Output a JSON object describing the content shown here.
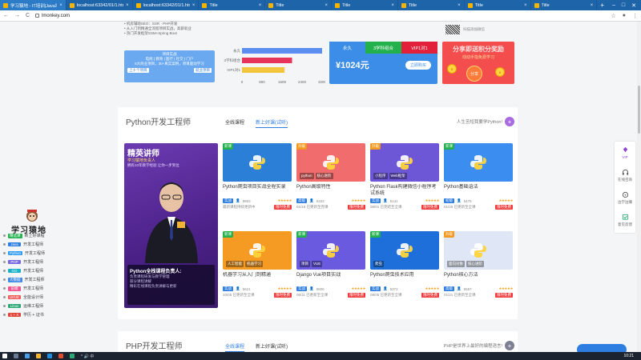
{
  "browser": {
    "tabs": [
      {
        "label": "学习猿地 - IT培训|Java培训",
        "active": true
      },
      {
        "label": "localhost:63342/01/1.html",
        "active": false
      },
      {
        "label": "localhost:63342/01/1.html",
        "active": false
      },
      {
        "label": "Title",
        "active": false
      },
      {
        "label": "Title",
        "active": false
      },
      {
        "label": "Title",
        "active": false
      },
      {
        "label": "Title",
        "active": false
      },
      {
        "label": "Title",
        "active": false
      },
      {
        "label": "Title",
        "active": false
      }
    ],
    "close_glyph": "×",
    "newtab_glyph": "+",
    "url": "lmonkey.com",
    "win_controls": {
      "min": "–",
      "max": "□",
      "close": "✕"
    },
    "nav": {
      "back": "←",
      "forward": "→",
      "reload": "C"
    },
    "addr_right": {
      "star": "☆",
      "account": "●",
      "menu": "⋮"
    }
  },
  "promo": {
    "lines": [
      "• 机房辅助SEO：SSR · PHP开发",
      "• 从入门到精通全流程项目实战，高薪就业",
      "• 热门开发框架SSM+Spring Boot"
    ],
    "notice_box": {
      "title": "项目实战",
      "line1": "电商 | 教育 | 医疗 | 社交 | 门户",
      "line2": "5大商业项目，30+真实案例，项目驱动学习",
      "btn_left": "上十个项目",
      "btn_right": "就业项目"
    },
    "mini_chart": {
      "categories": [
        "永久",
        "3学科组合",
        "VIP1对1"
      ],
      "ticks": [
        "0",
        "800",
        "1600",
        "2400",
        "3200"
      ]
    },
    "price_card": {
      "tabs": [
        "永久",
        "3学科组合",
        "VIP1对1"
      ],
      "price": "¥1024元",
      "buy": "立即购买"
    },
    "share_card": {
      "title": "分享即送积分奖励",
      "subtitle": "动动手指免费学习",
      "button": "分享"
    },
    "qr_text": "扫描添加微信"
  },
  "chart_data": {
    "type": "bar",
    "categories": [
      "永久",
      "3学科组合",
      "VIP1对1"
    ],
    "values": [
      3200,
      2000,
      1700
    ],
    "xlim": [
      0,
      3200
    ],
    "series_colors": [
      "#5b8ef0",
      "#e7345a",
      "#f3c53c"
    ]
  },
  "python_section": {
    "title": "Python开发工程师",
    "tabs": [
      "全线课程",
      "新上好课(试听)"
    ],
    "right_text": "人生苦短我要学Python!",
    "plus": "+",
    "teacher": {
      "title": "精英讲师",
      "subtitle": "学习猿地负责人",
      "subtitle2": "拥有10年教学经验 让你一步到位",
      "card_title": "Python全栈课程负责人:",
      "card_lines": [
        "负责课程研发与教学管理",
        "部分课程讲解",
        "精彩在线课程负责讲解与更新"
      ]
    },
    "courses": [
      {
        "badge": "新课",
        "badge_type": "new",
        "title": "Python爬虫项目实战全程实录",
        "level": "实战",
        "count": "8883",
        "date": "最新课程持续更新中",
        "free": "限时免费",
        "bg": "#2b7fd6",
        "chips": []
      },
      {
        "badge": "升级",
        "badge_type": "up",
        "title": "Python高级特性",
        "level": "高级",
        "count": "5333",
        "date": "01/18 已更新至完课",
        "free": "限时免费",
        "bg": "#f16c6c",
        "chips": [
          "python",
          "核心进阶"
        ]
      },
      {
        "badge": "升级",
        "badge_type": "up",
        "title": "Python Flask构建微信小程序考试系统",
        "level": "实战",
        "count": "5141",
        "date": "08/01 已完结至全课",
        "free": "限时免费",
        "bg": "#6e57d6",
        "chips": [
          "小程序",
          "Web框架"
        ]
      },
      {
        "badge": "新课",
        "badge_type": "new",
        "title": "Python基础语法",
        "level": "初级",
        "count": "5475",
        "date": "01/25 已更新至全课",
        "free": "限时免费",
        "bg": "#3b8ef0",
        "chips": []
      },
      {
        "badge": "新课",
        "badge_type": "new",
        "title": "机器学习从入门到精通",
        "level": "实战",
        "count": "5621",
        "date": "10/05 已更新至全课",
        "free": "限时免费",
        "bg": "#f59a23",
        "chips": [
          "人工智能",
          "机器学习"
        ]
      },
      {
        "badge": "新课",
        "badge_type": "new",
        "title": "Django Vue项目实战",
        "level": "实战",
        "count": "5806",
        "date": "06/11 已更新至全课",
        "free": "限时免费",
        "bg": "#6a5ae0",
        "chips": [
          "项目",
          "VUE"
        ]
      },
      {
        "badge": "新课",
        "badge_type": "new",
        "title": "Python爬虫技术应用",
        "level": "实战",
        "count": "5372",
        "date": "08/05 已更新至全课",
        "free": "限时免费",
        "bg": "#1e6fd9",
        "chips": [
          "爬虫"
        ]
      },
      {
        "badge": "升级",
        "badge_type": "up",
        "title": "Python核心方法",
        "level": "高级",
        "count": "5557",
        "date": "01/21 已更新至全课",
        "free": "限时免费",
        "bg": "#dfe6f5",
        "chips": [
          "面向对象",
          "核心进阶"
        ]
      }
    ],
    "stars": "★★★★★"
  },
  "php_section": {
    "title": "PHP开发工程师",
    "tabs": [
      "全线课程",
      "新上好课(试听)"
    ],
    "right_text": "PHP是世界上最好的编程语言!",
    "plus": "+"
  },
  "left_nav": {
    "logo": "学习猿地",
    "items": [
      {
        "tag": "精选课",
        "label": "新上好课程",
        "color": "#23b14d"
      },
      {
        "tag": "Java",
        "label": "开发工程师",
        "color": "#2e7de0"
      },
      {
        "tag": "Python",
        "label": "开发工程师",
        "color": "#2e9bf0"
      },
      {
        "tag": "PHP",
        "label": "开发工程师",
        "color": "#7a67e0"
      },
      {
        "tag": "GO",
        "label": "开发工程师",
        "color": "#1ab0c8"
      },
      {
        "tag": "大数据",
        "label": "开发工程师",
        "color": "#3c86e6"
      },
      {
        "tag": "前端",
        "label": "开发工程师",
        "color": "#f0568f"
      },
      {
        "tag": "UI/UE",
        "label": "全能设计师",
        "color": "#f25a5a"
      },
      {
        "tag": "Linux",
        "label": "运维工程师",
        "color": "#2aa876"
      },
      {
        "tag": "1 + X",
        "label": "学历 + 证书",
        "color": "#e2443c"
      }
    ]
  },
  "right_tools": [
    {
      "label": "VIP",
      "icon": "diamond-icon"
    },
    {
      "label": "在线咨询",
      "icon": "headset-icon"
    },
    {
      "label": "边学边赚",
      "icon": "coins-icon"
    },
    {
      "label": "意见反馈",
      "icon": "feedback-icon"
    }
  ],
  "taskbar": {
    "clock": "10:21",
    "tray": "^ 🔊 中"
  }
}
